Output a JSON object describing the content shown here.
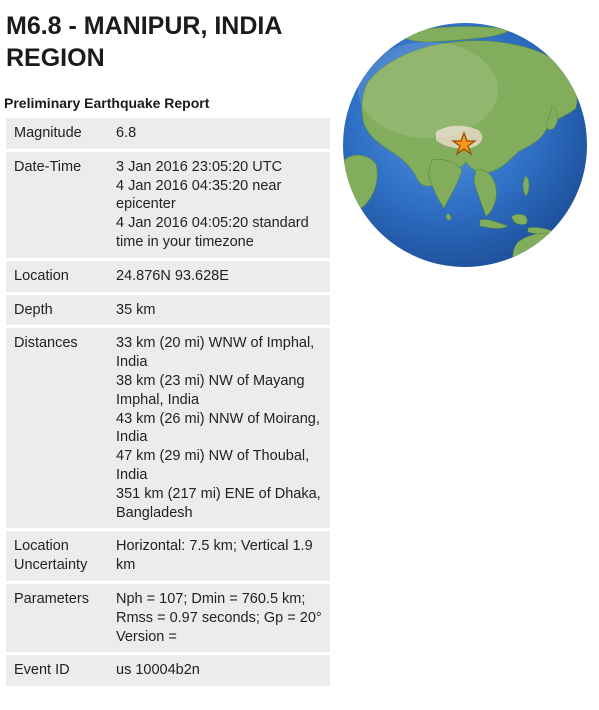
{
  "header": {
    "title": "M6.8 - MANIPUR, INDIA REGION",
    "subtitle": "Preliminary Earthquake Report"
  },
  "report": {
    "magnitude": {
      "label": "Magnitude",
      "value": "6.8"
    },
    "datetime": {
      "label": "Date-Time",
      "utc": "3 Jan 2016 23:05:20 UTC",
      "near_epicenter": "4 Jan 2016 04:35:20 near epicenter",
      "local": "4 Jan 2016 04:05:20 standard time in your timezone"
    },
    "location": {
      "label": "Location",
      "value": "24.876N 93.628E"
    },
    "depth": {
      "label": "Depth",
      "value": "35 km"
    },
    "distances": {
      "label": "Distances",
      "items": [
        "33 km (20 mi) WNW of Imphal, India",
        "38 km (23 mi) NW of Mayang Imphal, India",
        "43 km (26 mi) NNW of Moirang, India",
        "47 km (29 mi) NW of Thoubal, India",
        "351 km (217 mi) ENE of Dhaka, Bangladesh"
      ]
    },
    "uncertainty": {
      "label": "Location Uncertainty",
      "value": "Horizontal: 7.5 km; Vertical 1.9 km"
    },
    "parameters": {
      "label": "Parameters",
      "value": "Nph = 107; Dmin = 760.5 km; Rmss = 0.97 seconds; Gp = 20°",
      "version": "Version ="
    },
    "event_id": {
      "label": "Event ID",
      "value": "us 10004b2n"
    }
  },
  "globe": {
    "ocean_color": "#2f6fc4",
    "land_color": "#7fae5a",
    "marker_color": "#f39a1e",
    "marker_icon": "star-icon"
  }
}
